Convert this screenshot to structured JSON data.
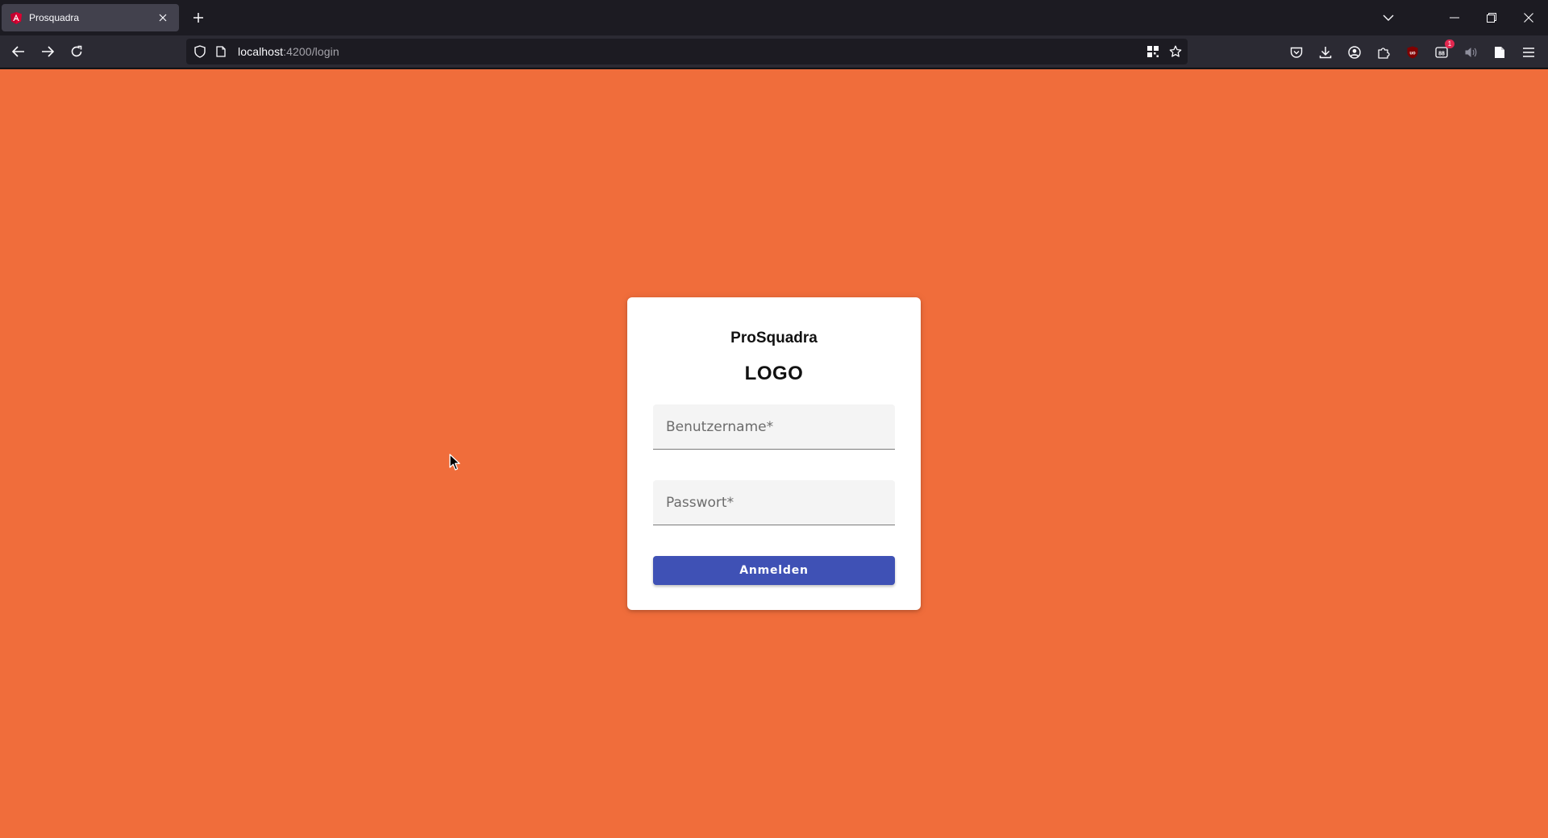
{
  "browser": {
    "tab": {
      "title": "Prosquadra",
      "favicon": "angular-icon"
    },
    "url": {
      "host": "localhost",
      "rest": ":4200/login"
    },
    "toolbar": {
      "notification_badge": "1"
    }
  },
  "login": {
    "brand": "ProSquadra",
    "logo_text": "LOGO",
    "username_placeholder": "Benutzername*",
    "password_placeholder": "Passwort*",
    "submit_label": "Anmelden"
  },
  "colors": {
    "page_background": "#f06d3b",
    "button_primary": "#3f51b5",
    "card": "#ffffff"
  }
}
